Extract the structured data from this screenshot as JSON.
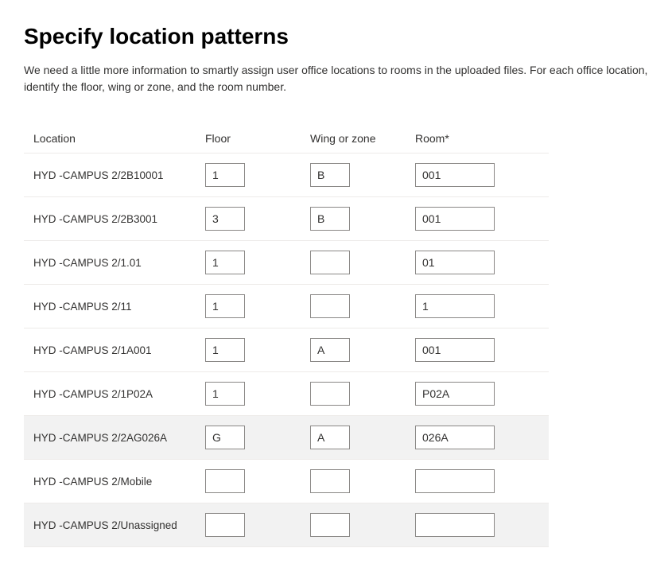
{
  "title": "Specify location patterns",
  "description": "We need a little more information to smartly assign user office locations to rooms in the uploaded files. For each office location, identify the floor, wing or zone, and the room number.",
  "headers": {
    "location": "Location",
    "floor": "Floor",
    "wing": "Wing or zone",
    "room": "Room*"
  },
  "rows": [
    {
      "location": "HYD -CAMPUS 2/2B10001",
      "floor": "1",
      "wing": "B",
      "room": "001",
      "alt": false
    },
    {
      "location": "HYD -CAMPUS 2/2B3001",
      "floor": "3",
      "wing": "B",
      "room": "001",
      "alt": false
    },
    {
      "location": "HYD -CAMPUS 2/1.01",
      "floor": "1",
      "wing": "",
      "room": "01",
      "alt": false
    },
    {
      "location": "HYD -CAMPUS 2/11",
      "floor": "1",
      "wing": "",
      "room": "1",
      "alt": false
    },
    {
      "location": "HYD -CAMPUS 2/1A001",
      "floor": "1",
      "wing": "A",
      "room": "001",
      "alt": false
    },
    {
      "location": "HYD -CAMPUS 2/1P02A",
      "floor": "1",
      "wing": "",
      "room": "P02A",
      "alt": false
    },
    {
      "location": "HYD -CAMPUS 2/2AG026A",
      "floor": "G",
      "wing": "A",
      "room": "026A",
      "alt": true
    },
    {
      "location": "HYD -CAMPUS 2/Mobile",
      "floor": "",
      "wing": "",
      "room": "",
      "alt": false
    },
    {
      "location": "HYD -CAMPUS 2/Unassigned",
      "floor": "",
      "wing": "",
      "room": "",
      "alt": true
    }
  ]
}
